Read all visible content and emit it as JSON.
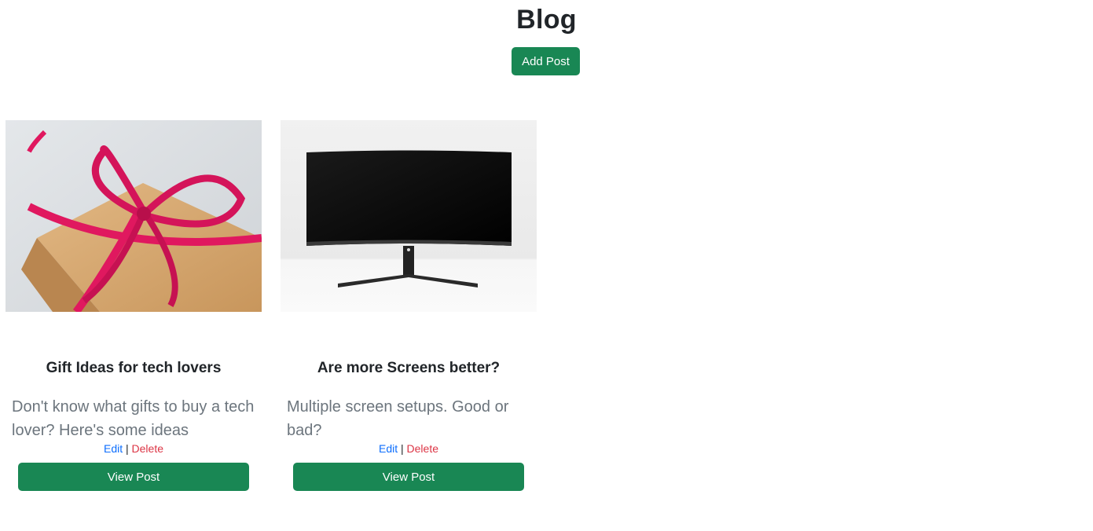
{
  "header": {
    "title": "Blog",
    "add_post_label": "Add Post"
  },
  "posts": [
    {
      "image": "gift-box-with-pink-ribbon",
      "title": "Gift Ideas for tech lovers",
      "summary": "Don't know what gifts to buy a tech lover? Here's some ideas",
      "edit_label": "Edit",
      "separator": "|",
      "delete_label": "Delete",
      "view_label": "View Post"
    },
    {
      "image": "curved-monitor",
      "title": "Are more Screens better?",
      "summary": "Multiple screen setups. Good or bad?",
      "edit_label": "Edit",
      "separator": "|",
      "delete_label": "Delete",
      "view_label": "View Post"
    }
  ],
  "colors": {
    "primary_green": "#198754",
    "link_blue": "#0d6efd",
    "delete_red": "#dc3545",
    "muted_text": "#6c757d"
  }
}
